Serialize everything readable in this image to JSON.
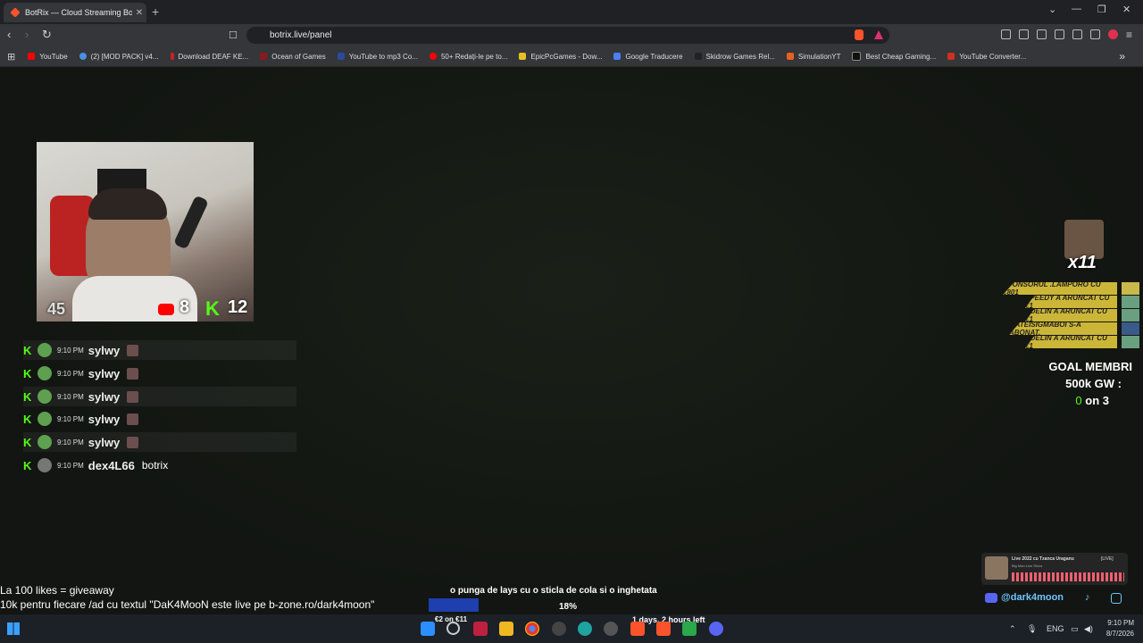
{
  "browser": {
    "tab_title": "BotRix — Cloud Streaming Bot f",
    "tab_close": "✕",
    "new_tab": "+",
    "url": "botrix.live/panel",
    "bookmarks": [
      {
        "label": "YouTube",
        "color": "#ff0000"
      },
      {
        "label": "(2) [MOD PACK] v4...",
        "color": "#4a90e2"
      },
      {
        "label": "Download DEAF KE...",
        "color": "#cc2222"
      },
      {
        "label": "Ocean of Games",
        "color": "#8b1a1a"
      },
      {
        "label": "YouTube to mp3 Co...",
        "color": "#2a4a9a"
      },
      {
        "label": "50+ Redați-le pe to...",
        "color": "#ff0000"
      },
      {
        "label": "EpicPcGames - Dow...",
        "color": "#e8c020"
      },
      {
        "label": "Google Traducere",
        "color": "#4a80f0"
      },
      {
        "label": "Skidrow Games Rel...",
        "color": "#222222"
      },
      {
        "label": "SimulationYT",
        "color": "#e86020"
      },
      {
        "label": "Best Cheap Gaming...",
        "color": "#111111"
      },
      {
        "label": "YouTube Converter...",
        "color": "#d03020"
      }
    ],
    "bookmarks_more": "»"
  },
  "overlay": {
    "cam_stats": {
      "likes": "45",
      "youtube_viewers": "8",
      "kick_viewers": "12"
    },
    "chat": [
      {
        "time": "9:10 PM",
        "user": "sylwy",
        "message": ""
      },
      {
        "time": "9:10 PM",
        "user": "sylwy",
        "message": ""
      },
      {
        "time": "9:10 PM",
        "user": "sylwy",
        "message": ""
      },
      {
        "time": "9:10 PM",
        "user": "sylwy",
        "message": ""
      },
      {
        "time": "9:10 PM",
        "user": "sylwy",
        "message": ""
      },
      {
        "time": "9:10 PM",
        "user": "dex4L66",
        "message": "botrix"
      }
    ],
    "multiplier": "x11",
    "alerts": [
      "SPONSORUL .LAMPORO CU €801",
      "SPEEDY A ARUNCAT CU €1",
      "ADELIN A ARUNCAT CU €1",
      "MATEISIGMABOI S-A ABONAT.",
      "ADELIN A ARUNCAT CU €1"
    ],
    "goal": {
      "line1": "GOAL MEMBRI",
      "line2": "500k GW :",
      "current": "0",
      "suffix": "on 3"
    },
    "bottom_left_line1": "La 100 likes = giveaway",
    "bottom_left_line2": "10k pentru fiecare /ad cu textul \"DaK4MooN este live pe b-zone.ro/dark4moon\"",
    "center_message": "o punga de lays cu o sticla de cola si o inghetata",
    "center_percent": "18%",
    "donation_goal": "€2 on €11",
    "timer": "1 days, 2 hours left",
    "now_playing_title": "Live 2022 cu Tzanca Uraganu",
    "now_playing_badge": "[LIVE]",
    "now_playing_sub": "Big Man Live Show",
    "discord_handle": "@dark4moon"
  },
  "taskbar": {
    "language": "ENG",
    "time": "9:10 PM",
    "date": "8/7/2026"
  },
  "colors": {
    "kick_green": "#53fc18",
    "alert_gold": "#ccb637",
    "progress_blue": "#1e3fae"
  }
}
